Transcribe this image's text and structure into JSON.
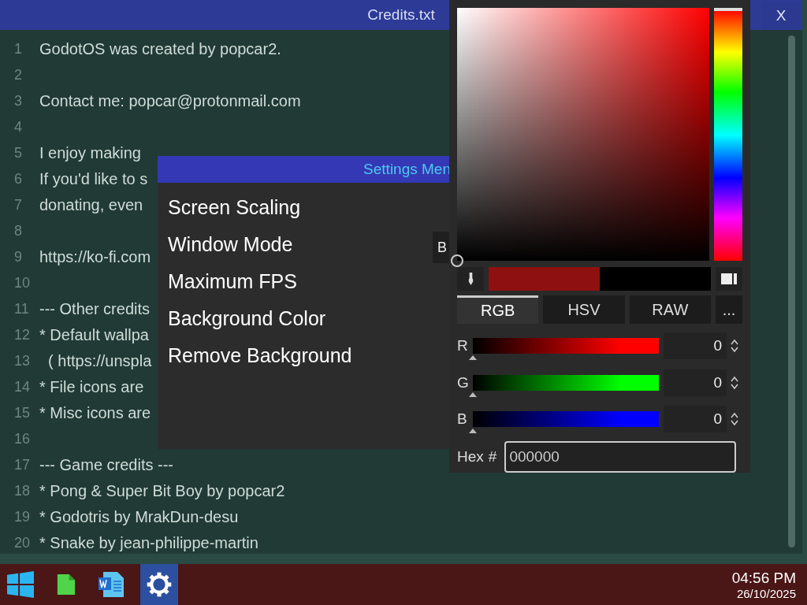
{
  "editor": {
    "title": "Credits.txt",
    "close": "X",
    "lines": [
      {
        "number": "1",
        "text": "GodotOS was created by popcar2."
      },
      {
        "number": "2"
      },
      {
        "number": "3",
        "text": "Contact me: popcar@protonmail.com"
      },
      {
        "number": "4"
      },
      {
        "number": "5",
        "text": "I enjoy making"
      },
      {
        "number": "6",
        "text": "If you'd like to s"
      },
      {
        "number": "7",
        "text": "donating, even"
      },
      {
        "number": "8"
      },
      {
        "number": "9",
        "text": "https://ko-fi.com"
      },
      {
        "number": "10"
      },
      {
        "number": "11",
        "text": "--- Other credits"
      },
      {
        "number": "12",
        "text": "* Default wallpa"
      },
      {
        "number": "13",
        "text": "  ( https://unspla"
      },
      {
        "number": "14",
        "text": "* File icons are"
      },
      {
        "number": "15",
        "text": "* Misc icons are"
      },
      {
        "number": "16"
      },
      {
        "number": "17",
        "text": "--- Game credits ---"
      },
      {
        "number": "18",
        "text": "* Pong & Super Bit Boy by popcar2"
      },
      {
        "number": "19",
        "text": "* Godotris by MrakDun-desu"
      },
      {
        "number": "20",
        "text": "* Snake by jean-philippe-martin"
      }
    ]
  },
  "settings_menu": {
    "title": "Settings Men",
    "items": [
      "Screen Scaling",
      "Window Mode",
      "Maximum FPS",
      "Background Color",
      "Remove Background"
    ],
    "button": "B"
  },
  "color_picker": {
    "hue": {
      "level": 0
    },
    "old_color": {
      "color": "#8f1010"
    },
    "new_color": {
      "color": "#000000"
    },
    "modes": [
      {
        "label": "RGB",
        "selected": true
      },
      {
        "label": "HSV",
        "selected": false
      },
      {
        "label": "RAW",
        "selected": false
      }
    ],
    "more": "...",
    "channels": [
      {
        "label": "R",
        "color": "#ff0000",
        "level": 0,
        "value": "0"
      },
      {
        "label": "G",
        "color": "#00ff00",
        "level": 0,
        "value": "0"
      },
      {
        "label": "B",
        "color": "#0000ff",
        "level": 0,
        "value": "0"
      }
    ],
    "hex_label": "Hex",
    "hash": "#",
    "hex_value": "000000"
  },
  "taskbar": {
    "apps": [
      {
        "kind": "start",
        "selected": false
      },
      {
        "kind": "files",
        "selected": false
      },
      {
        "kind": "document",
        "selected": false
      },
      {
        "kind": "settings",
        "selected": true
      }
    ],
    "time": "04:56 PM",
    "date": "26/10/2025"
  }
}
